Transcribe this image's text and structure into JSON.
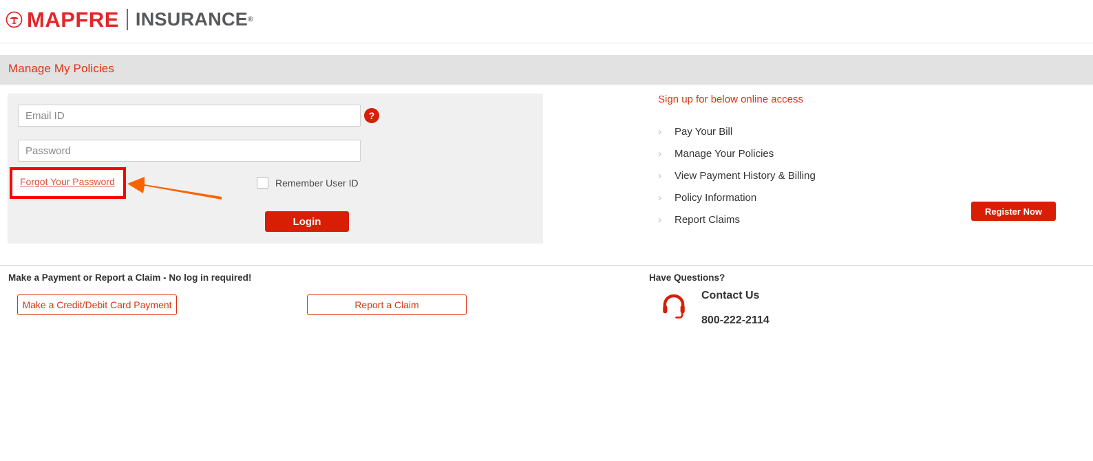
{
  "brand": {
    "mark_icon": "mapfre-circle-tree-icon",
    "name": "MAPFRE",
    "product": "INSURANCE",
    "trademark": "®",
    "brand_red": "#e3262b",
    "product_gray": "#58595b"
  },
  "section": {
    "title": "Manage My Policies",
    "bar_color": "#e2e2e2",
    "title_color": "#dd3311"
  },
  "login": {
    "email_placeholder": "Email ID",
    "email_value": "",
    "password_placeholder": "Password",
    "password_value": "",
    "help_icon_label": "?",
    "forgot_link": "Forgot Your Password",
    "remember_label": "Remember User ID",
    "remember_checked": false,
    "login_button": "Login",
    "button_color": "#d81e05",
    "panel_color": "#f0f0f0"
  },
  "annotation": {
    "highlight_color": "#fb0000",
    "arrow_color": "#fa6400",
    "target": "forgot-your-password-link"
  },
  "signup": {
    "title": "Sign up for below online access",
    "items": [
      {
        "label": "Pay Your Bill",
        "icon": "chevron-right-icon"
      },
      {
        "label": "Manage Your Policies",
        "icon": "chevron-right-icon"
      },
      {
        "label": "View Payment History & Billing",
        "icon": "chevron-right-icon"
      },
      {
        "label": "Policy Information",
        "icon": "chevron-right-icon"
      },
      {
        "label": "Report Claims",
        "icon": "chevron-right-icon"
      }
    ],
    "register_button": "Register Now"
  },
  "footer": {
    "heading": "Make a Payment or Report a Claim - No log in required!",
    "payment_button": "Make a Credit/Debit Card Payment",
    "claim_button": "Report a Claim",
    "questions_heading": "Have Questions?",
    "contact_icon": "headset-icon",
    "contact_label": "Contact Us",
    "contact_phone": "800-222-2114",
    "accent_color": "#dd3311"
  }
}
